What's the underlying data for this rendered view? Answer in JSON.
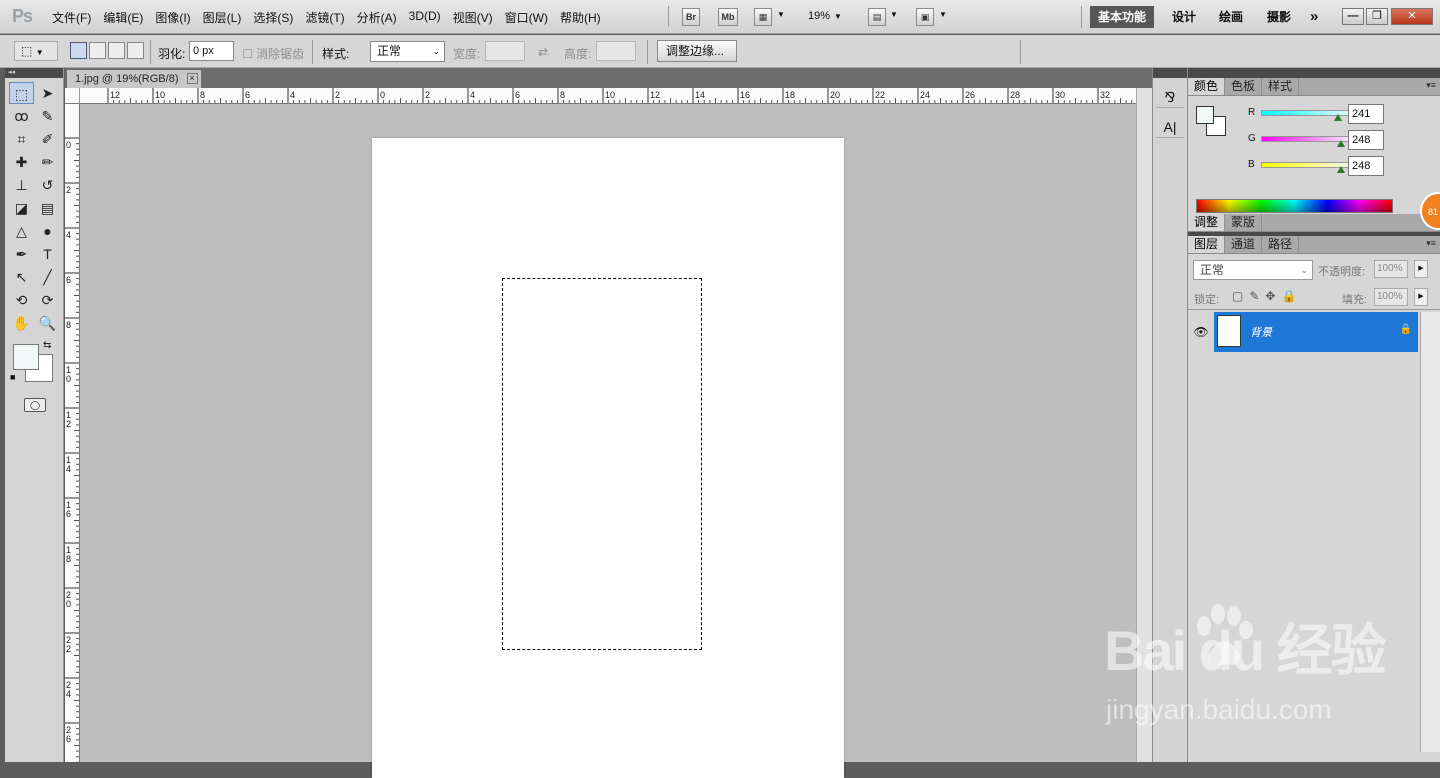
{
  "app": {
    "logo": "Ps"
  },
  "menu": {
    "items": [
      "文件(F)",
      "编辑(E)",
      "图像(I)",
      "图层(L)",
      "选择(S)",
      "滤镜(T)",
      "分析(A)",
      "3D(D)",
      "视图(V)",
      "窗口(W)",
      "帮助(H)"
    ]
  },
  "appbar": {
    "bridge": "Br",
    "minibridge": "Mb",
    "zoom": "19%"
  },
  "workspaces": {
    "active": "基本功能",
    "items": [
      "设计",
      "绘画",
      "摄影"
    ],
    "more": "»"
  },
  "window_buttons": {
    "min": "—",
    "restore": "❐",
    "close": "✕"
  },
  "options": {
    "feather_label": "羽化:",
    "feather_value": "0 px",
    "antialias_label": "消除锯齿",
    "style_label": "样式:",
    "style_value": "正常",
    "width_label": "宽度:",
    "height_label": "高度:",
    "refine_button": "调整边缘..."
  },
  "document": {
    "tab_title": "1.jpg @ 19%(RGB/8)"
  },
  "ruler": {
    "h_ticks": [
      "12",
      "10",
      "8",
      "6",
      "4",
      "2",
      "0",
      "2",
      "4",
      "6",
      "8",
      "10",
      "12",
      "14",
      "16",
      "18",
      "20",
      "22",
      "24",
      "26",
      "28",
      "30",
      "32"
    ],
    "v_ticks": [
      "0",
      "2",
      "4",
      "6",
      "8",
      "10",
      "12",
      "14",
      "16",
      "18",
      "20",
      "22",
      "24",
      "26"
    ]
  },
  "color_panel": {
    "tabs": [
      "颜色",
      "色板",
      "样式"
    ],
    "channels": [
      {
        "label": "R",
        "value": "241",
        "gradient": "linear-gradient(90deg,#00ffff,#f1f8f8)"
      },
      {
        "label": "G",
        "value": "248",
        "gradient": "linear-gradient(90deg,#ff00ff,#f1f8f8)"
      },
      {
        "label": "B",
        "value": "248",
        "gradient": "linear-gradient(90deg,#ffff00,#f1f8f8)"
      }
    ],
    "foreground": "#f1f8f8",
    "background": "#ffffff"
  },
  "adjust_panel": {
    "tabs": [
      "调整",
      "蒙版"
    ]
  },
  "layers_panel": {
    "tabs": [
      "图层",
      "通道",
      "路径"
    ],
    "blend_mode": "正常",
    "opacity_label": "不透明度:",
    "opacity_value": "100%",
    "lock_label": "锁定:",
    "fill_label": "填充:",
    "fill_value": "100%",
    "layers": [
      {
        "name": "背景",
        "locked": true
      }
    ]
  },
  "badge": {
    "text": "81"
  },
  "watermark": {
    "line1": "Bai du 经验",
    "line2": "jingyan.baidu.com"
  },
  "colors": {
    "accent": "#1e78d6",
    "canvas_bg": "#bebebe",
    "badge": "#f08020"
  }
}
